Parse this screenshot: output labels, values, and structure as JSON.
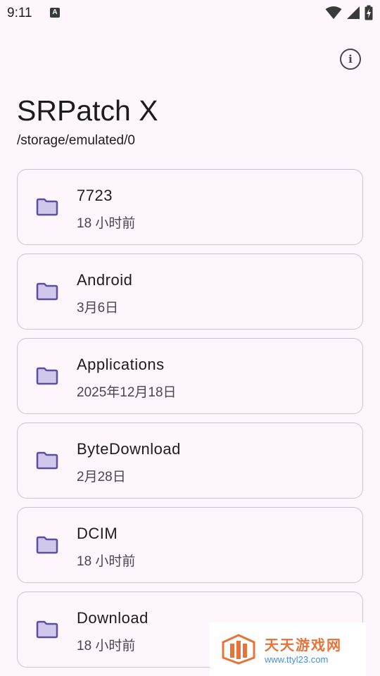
{
  "status_bar": {
    "time": "9:11",
    "notification_icon": "A",
    "icons": [
      "wifi-icon",
      "signal-icon",
      "battery-charging-icon"
    ]
  },
  "app": {
    "title": "SRPatch X",
    "path": "/storage/emulated/0",
    "info_icon": "i"
  },
  "files": [
    {
      "name": "7723",
      "date": "18 小时前",
      "icon": "folder-icon"
    },
    {
      "name": "Android",
      "date": "3月6日",
      "icon": "folder-icon"
    },
    {
      "name": "Applications",
      "date": "2025年12月18日",
      "icon": "folder-icon"
    },
    {
      "name": "ByteDownload",
      "date": "2月28日",
      "icon": "folder-icon"
    },
    {
      "name": "DCIM",
      "date": "18 小时前",
      "icon": "folder-icon"
    },
    {
      "name": "Download",
      "date": "18 小时前",
      "icon": "folder-icon"
    }
  ],
  "watermark": {
    "title": "天天游戏网",
    "url": "www.ttyl23.com"
  },
  "colors": {
    "background": "#fdf7fd",
    "folder_fill": "#d0c7ea",
    "folder_stroke": "#5e4f9e",
    "card_border": "#cac4d0"
  }
}
